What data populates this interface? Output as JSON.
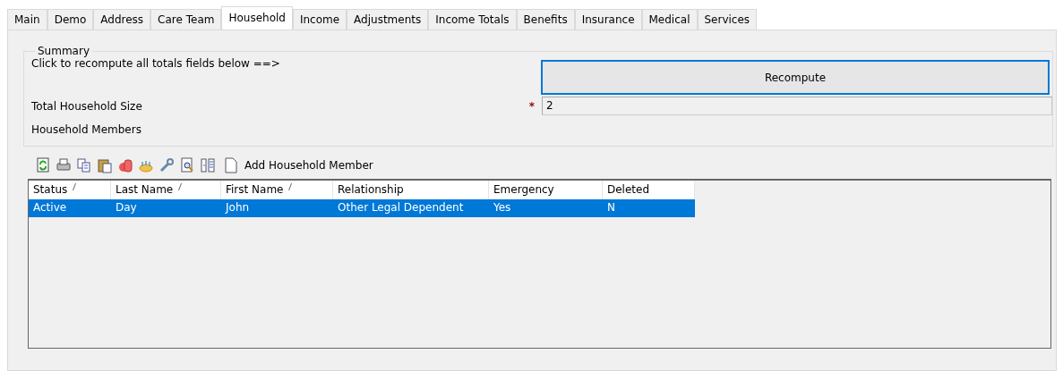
{
  "tabs": [
    {
      "label": "Main",
      "selected": false
    },
    {
      "label": "Demo",
      "selected": false
    },
    {
      "label": "Address",
      "selected": false
    },
    {
      "label": "Care Team",
      "selected": false
    },
    {
      "label": "Household",
      "selected": true
    },
    {
      "label": "Income",
      "selected": false
    },
    {
      "label": "Adjustments",
      "selected": false
    },
    {
      "label": "Income Totals",
      "selected": false
    },
    {
      "label": "Benefits",
      "selected": false
    },
    {
      "label": "Insurance",
      "selected": false
    },
    {
      "label": "Medical",
      "selected": false
    },
    {
      "label": "Services",
      "selected": false
    }
  ],
  "summary": {
    "title": "Summary",
    "recompute_hint": "Click to recompute all totals fields below ==>",
    "recompute_button": "Recompute",
    "total_household_size": {
      "label": "Total Household Size",
      "required_mark": "*",
      "value": "2"
    },
    "household_members_label": "Household Members"
  },
  "toolbar": {
    "icons": [
      {
        "kind": "refresh"
      },
      {
        "kind": "print"
      },
      {
        "kind": "copy"
      },
      {
        "kind": "paste"
      },
      {
        "kind": "delete"
      },
      {
        "kind": "cake"
      },
      {
        "kind": "wrench"
      },
      {
        "kind": "preview"
      },
      {
        "kind": "columns"
      }
    ],
    "add_button": "Add Household Member"
  },
  "table": {
    "columns": [
      {
        "label": "Status",
        "sortable": true
      },
      {
        "label": "Last Name",
        "sortable": true
      },
      {
        "label": "First Name",
        "sortable": true
      },
      {
        "label": "Relationship",
        "sortable": false
      },
      {
        "label": "Emergency",
        "sortable": false
      },
      {
        "label": "Deleted",
        "sortable": false
      }
    ],
    "rows": [
      {
        "selected": true,
        "cells": [
          "Active",
          "Day",
          "John",
          "Other Legal Dependent",
          "Yes",
          "N"
        ]
      }
    ]
  }
}
